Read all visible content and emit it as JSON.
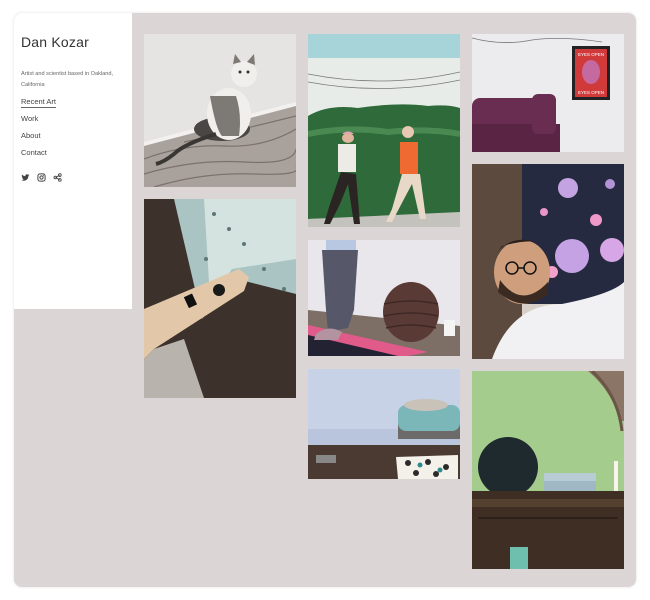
{
  "site": {
    "title": "Dan Kozar",
    "tagline": "Artist and scientist based in Oakland, California"
  },
  "nav": {
    "items": [
      {
        "label": "Recent Art",
        "active": true
      },
      {
        "label": "Work",
        "active": false
      },
      {
        "label": "About",
        "active": false
      },
      {
        "label": "Contact",
        "active": false
      }
    ]
  },
  "social": {
    "icons": [
      "twitter-icon",
      "instagram-icon",
      "share-icon"
    ]
  },
  "gallery": {
    "images": [
      "painting-cat-on-wood-floor",
      "painting-two-joggers-hedge",
      "painting-purple-couch-poster",
      "painting-hand-on-table",
      "painting-legs-and-ottoman",
      "painting-man-with-glasses",
      "painting-couch-and-rug",
      "painting-dresser-and-mirror"
    ],
    "poster_text": {
      "top": "EYES OPEN",
      "bottom": "EYES OPEN"
    }
  },
  "colors": {
    "frame_bg": "#dcd5d5",
    "sidebar_bg": "#ffffff",
    "text": "#333333"
  }
}
